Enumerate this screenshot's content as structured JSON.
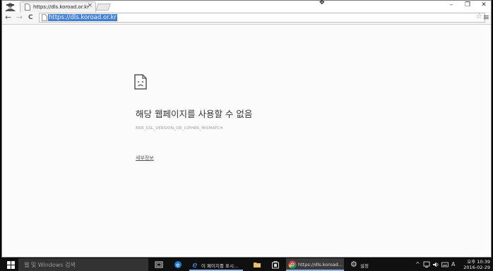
{
  "browser": {
    "tab_title": "https://dls.koroad.or.kr/을",
    "tab_close": "×",
    "url": "https://dls.koroad.or.kr",
    "window_controls": {
      "minimize": "–",
      "maximize": "❐",
      "close": "✕"
    },
    "nav": {
      "back": "←",
      "forward": "→",
      "reload": "C"
    },
    "star": "☆",
    "menu": "≡"
  },
  "error_page": {
    "heading": "해당 웹페이지를 사용할 수 없음",
    "code": "ERR_SSL_VERSION_OR_CIPHER_MISMATCH",
    "details_link": "세부정보"
  },
  "taskbar": {
    "search_placeholder": "웹 및 Windows 검색",
    "apps": [
      {
        "label": "이 페이지를 표시..."
      },
      {
        "label": "https://dls.koroad..."
      },
      {
        "label": "설정"
      }
    ],
    "tray": {
      "chevron": "^",
      "lang": "A"
    },
    "clock_time": "오후 10:39",
    "clock_date": "2016-02-29"
  },
  "colors": {
    "url_highlight": "#3d7ee0",
    "taskbar": "#101010",
    "page_background": "#fbfbfb"
  }
}
